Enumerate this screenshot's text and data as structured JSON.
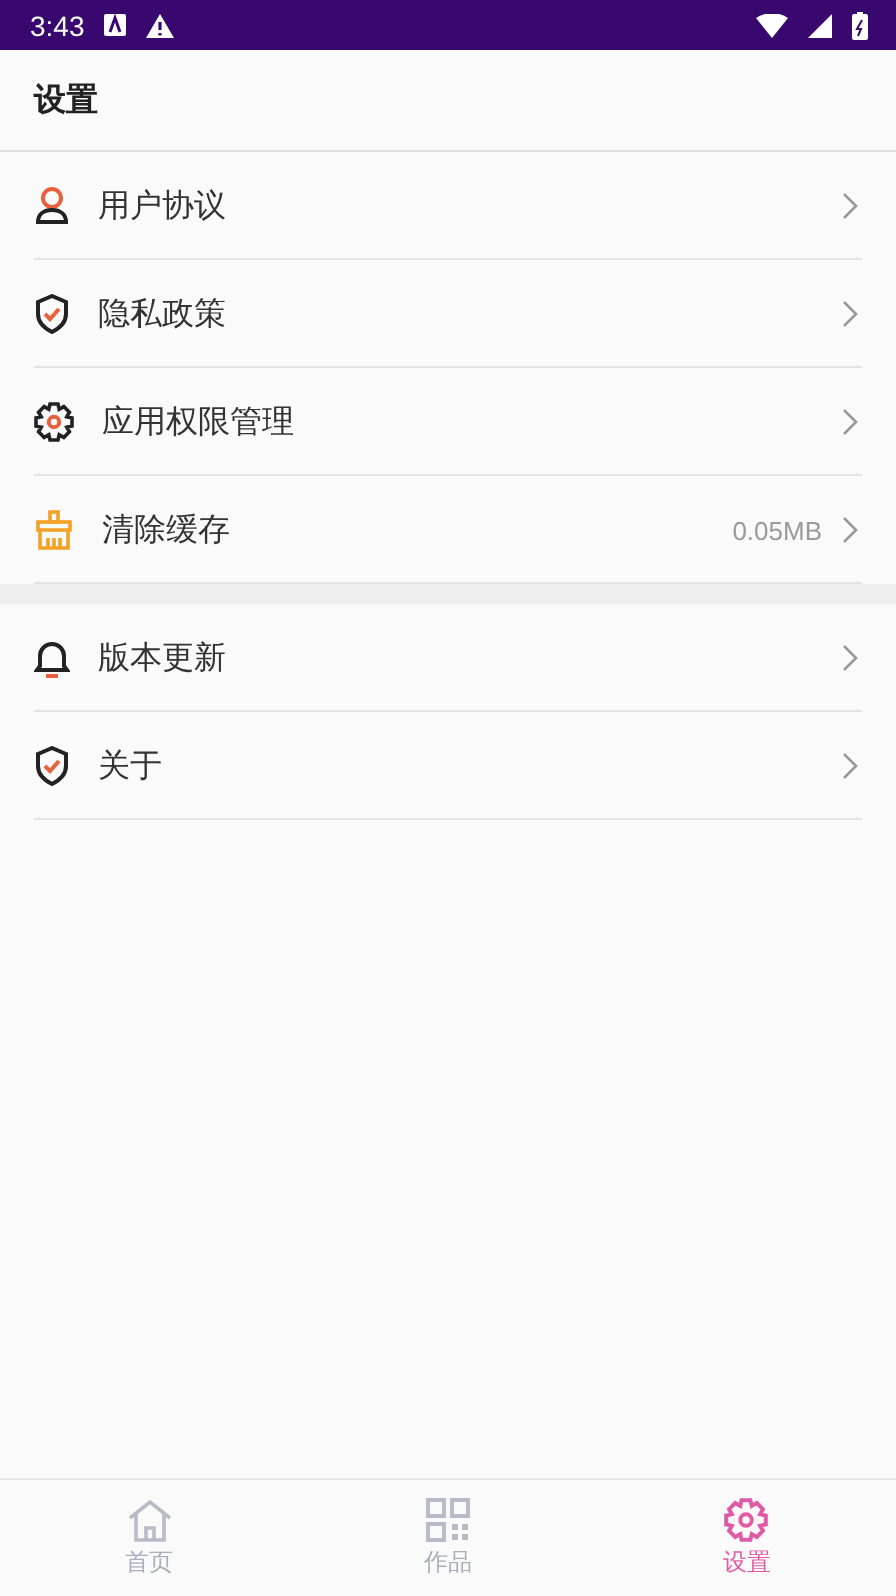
{
  "status_bar": {
    "time": "3:43"
  },
  "header": {
    "title": "设置"
  },
  "groups": [
    {
      "items": [
        {
          "label": "用户协议"
        },
        {
          "label": "隐私政策"
        },
        {
          "label": "应用权限管理"
        },
        {
          "label": "清除缓存",
          "value": "0.05MB"
        }
      ]
    },
    {
      "items": [
        {
          "label": "版本更新"
        },
        {
          "label": "关于"
        }
      ]
    }
  ],
  "tab_bar": [
    {
      "label": "首页",
      "selected": false
    },
    {
      "label": "作品",
      "selected": false
    },
    {
      "label": "设置",
      "selected": true
    }
  ]
}
